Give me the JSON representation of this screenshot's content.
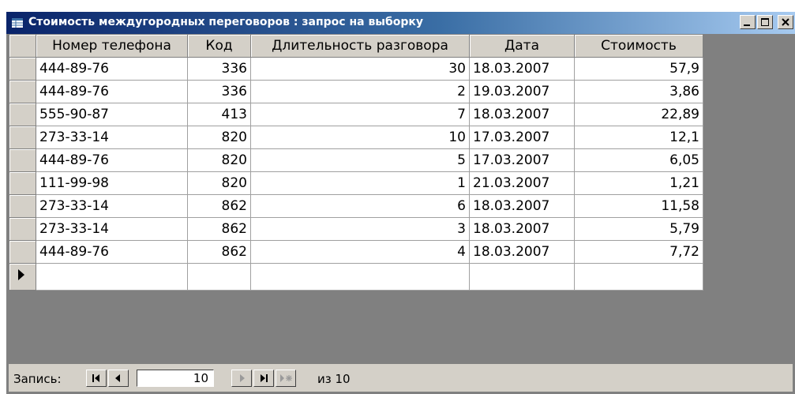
{
  "window": {
    "title": "Стоимость междугородных переговоров : запрос на выборку"
  },
  "grid": {
    "columns": [
      "Номер телефона",
      "Код",
      "Длительность разговора",
      "Дата",
      "Стоимость"
    ],
    "rows": [
      [
        "444-89-76",
        "336",
        "30",
        "18.03.2007",
        "57,9"
      ],
      [
        "444-89-76",
        "336",
        "2",
        "19.03.2007",
        "3,86"
      ],
      [
        "555-90-87",
        "413",
        "7",
        "18.03.2007",
        "22,89"
      ],
      [
        "273-33-14",
        "820",
        "10",
        "17.03.2007",
        "12,1"
      ],
      [
        "444-89-76",
        "820",
        "5",
        "17.03.2007",
        "6,05"
      ],
      [
        "111-99-98",
        "820",
        "1",
        "21.03.2007",
        "1,21"
      ],
      [
        "273-33-14",
        "862",
        "6",
        "18.03.2007",
        "11,58"
      ],
      [
        "273-33-14",
        "862",
        "3",
        "18.03.2007",
        "5,79"
      ],
      [
        "444-89-76",
        "862",
        "4",
        "18.03.2007",
        "7,72"
      ]
    ]
  },
  "nav": {
    "label": "Запись:",
    "current_record": "10",
    "total": "из 10"
  },
  "colors": {
    "titlebar_start": "#0a246a",
    "titlebar_end": "#a6caf0",
    "face": "#d4d0c8",
    "workspace": "#808080"
  }
}
